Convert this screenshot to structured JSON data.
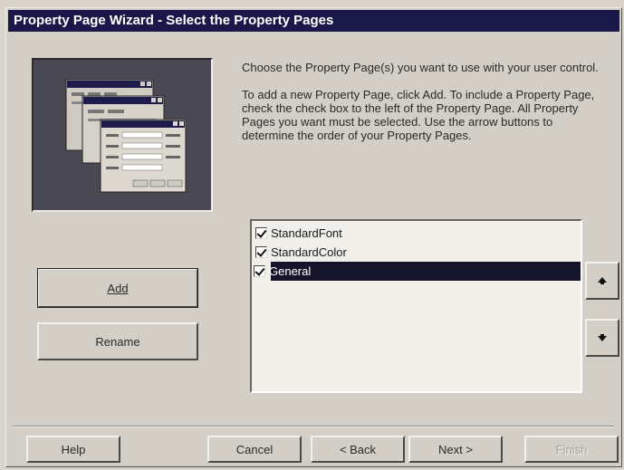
{
  "window": {
    "title": "Property Page Wizard - Select the Property Pages"
  },
  "instructions": {
    "paragraph1": "Choose the Property Page(s) you want to use with your user control.",
    "paragraph2": "To add a new Property Page, click Add. To include a Property Page, check the check box to the left of the Property Page. All Property Pages you want must be selected. Use the arrow buttons to determine the order of your Property Pages."
  },
  "property_pages": [
    {
      "label": "StandardFont",
      "checked": true,
      "selected": false
    },
    {
      "label": "StandardColor",
      "checked": true,
      "selected": false
    },
    {
      "label": "General",
      "checked": true,
      "selected": true
    }
  ],
  "buttons": {
    "add": "Add",
    "rename": "Rename",
    "move_up_icon": "up-arrow",
    "move_down_icon": "down-arrow",
    "help": "Help",
    "cancel": "Cancel",
    "back": "< Back",
    "next": "Next >",
    "finish": "Finish"
  },
  "colors": {
    "titlebar": "#1a1848",
    "selection": "#15142a",
    "face": "#d3cec6"
  }
}
